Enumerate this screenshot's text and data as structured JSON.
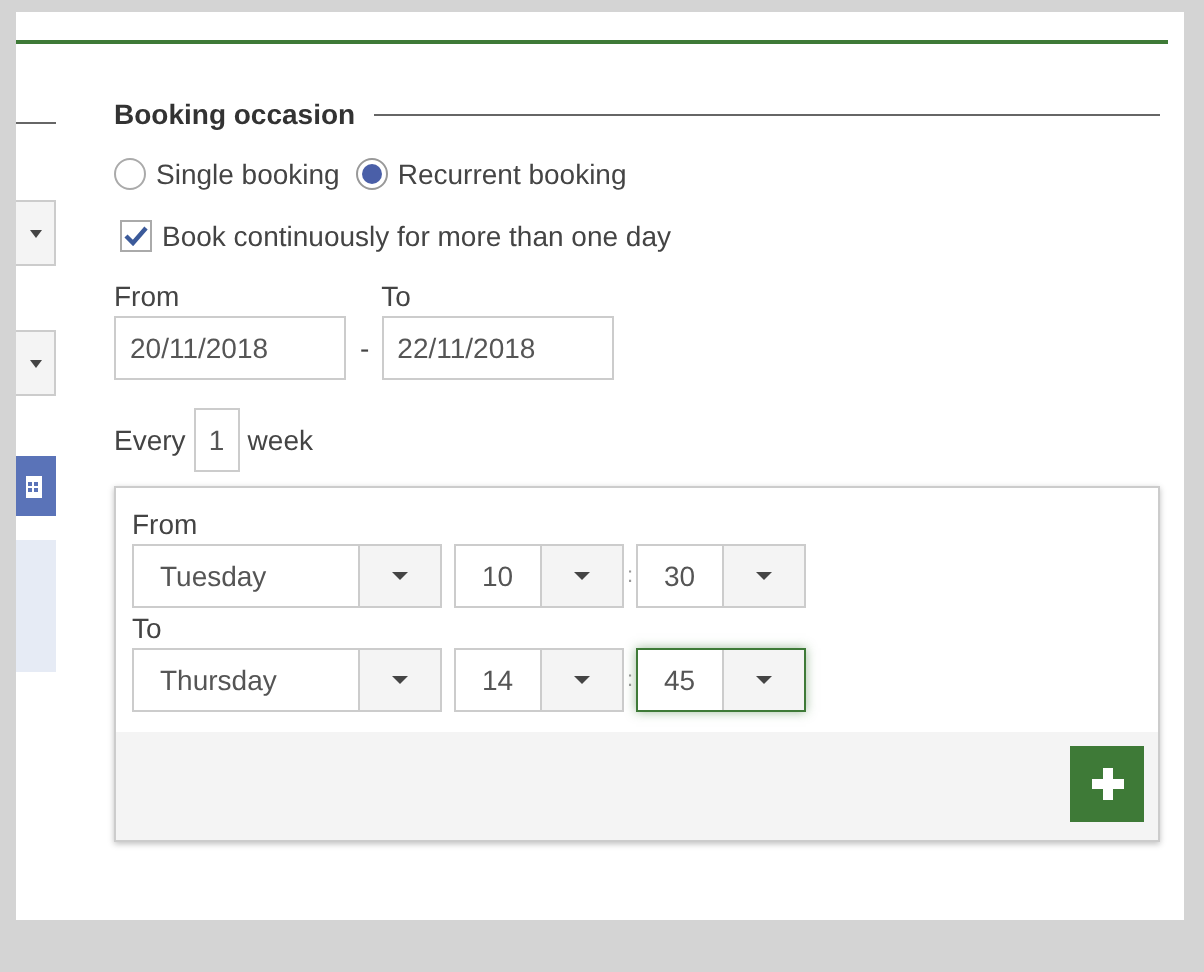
{
  "section_title": "Booking occasion",
  "booking_types": [
    {
      "label": "Single booking",
      "selected": false
    },
    {
      "label": "Recurrent booking",
      "selected": true
    }
  ],
  "continuous": {
    "label": "Book continuously for more than one day",
    "checked": true
  },
  "date_range": {
    "from_label": "From",
    "from_value": "20/11/2018",
    "separator": "-",
    "to_label": "To",
    "to_value": "22/11/2018"
  },
  "interval": {
    "prefix": "Every",
    "value": "1",
    "unit": "week"
  },
  "time_range": [
    {
      "label": "From",
      "day": "Tuesday",
      "hour": "10",
      "minute": "30",
      "focused": false
    },
    {
      "label": "To",
      "day": "Thursday",
      "hour": "14",
      "minute": "45",
      "focused": true
    }
  ],
  "time_separator": ":"
}
